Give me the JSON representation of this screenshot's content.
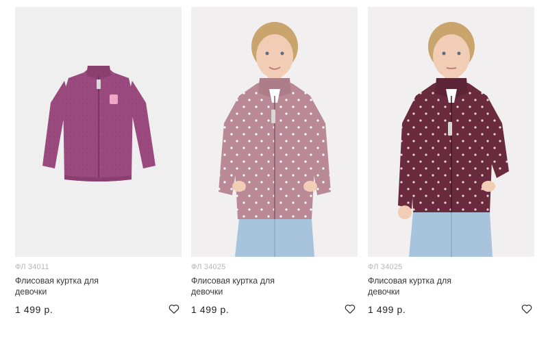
{
  "products": [
    {
      "article": "ФЛ 34011",
      "title": "Флисовая куртка для девочки",
      "price": "1 499 р.",
      "image": "flatlay-jacket-image",
      "color": "#9a4a7e"
    },
    {
      "article": "ФЛ 34025",
      "title": "Флисовая куртка для девочки",
      "price": "1 499 р.",
      "image": "model-jacket-image",
      "color": "#b98a96"
    },
    {
      "article": "ФЛ 34025",
      "title": "Флисовая куртка для девочки",
      "price": "1 499 р.",
      "image": "model-jacket-image",
      "color": "#6a2b3f"
    }
  ],
  "icons": {
    "favorite": "heart-outline-icon"
  }
}
